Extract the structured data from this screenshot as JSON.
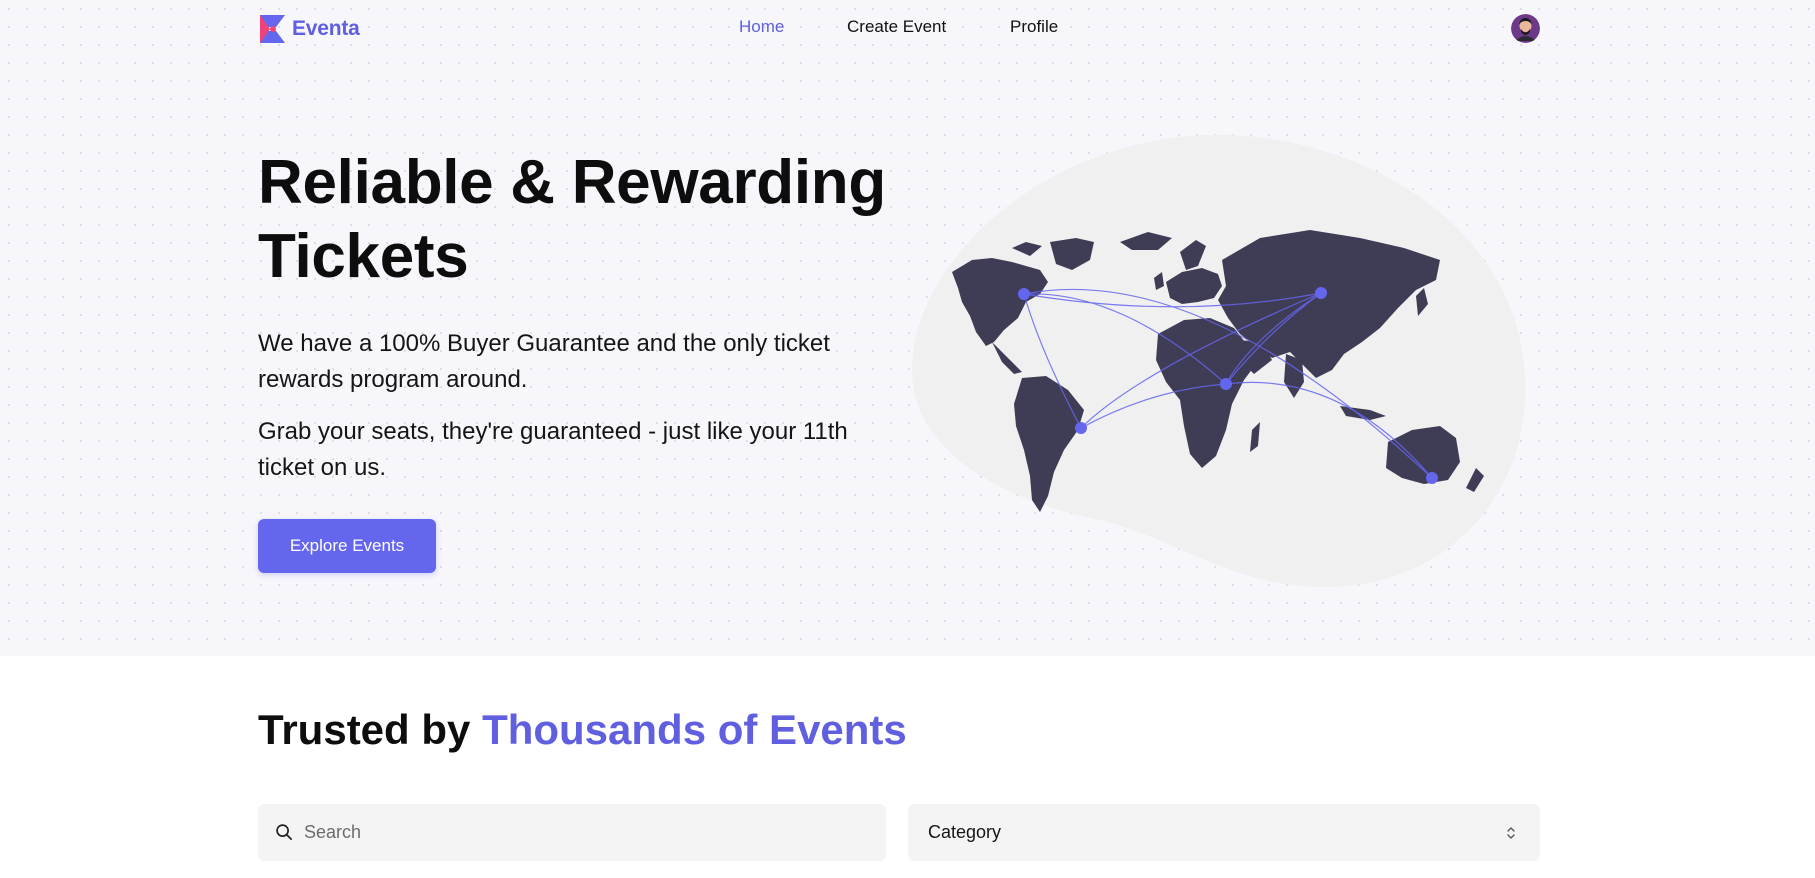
{
  "brand": {
    "name": "Eventa",
    "accent_color": "#5f5fe0",
    "logo_colors": [
      "#f0427a",
      "#6566ee"
    ]
  },
  "nav": {
    "items": [
      {
        "label": "Home",
        "active": true
      },
      {
        "label": "Create Event",
        "active": false
      },
      {
        "label": "Profile",
        "active": false
      }
    ],
    "avatar_icon": "user-avatar"
  },
  "hero": {
    "title": "Reliable & Rewarding Tickets",
    "paragraph_1": "We have a 100% Buyer Guarantee and the only ticket rewards program around.",
    "paragraph_2": "Grab your seats, they're guaranteed - just like your 11th ticket on us.",
    "cta_label": "Explore Events",
    "cta_color": "#6566ee",
    "illustration": "world-map-connections"
  },
  "trusted": {
    "title_plain": "Trusted by ",
    "title_accent": "Thousands of Events"
  },
  "filters": {
    "search": {
      "placeholder": "Search",
      "value": "",
      "icon": "search-icon"
    },
    "category": {
      "selected": "Category",
      "icon": "chevron-updown-icon"
    }
  }
}
